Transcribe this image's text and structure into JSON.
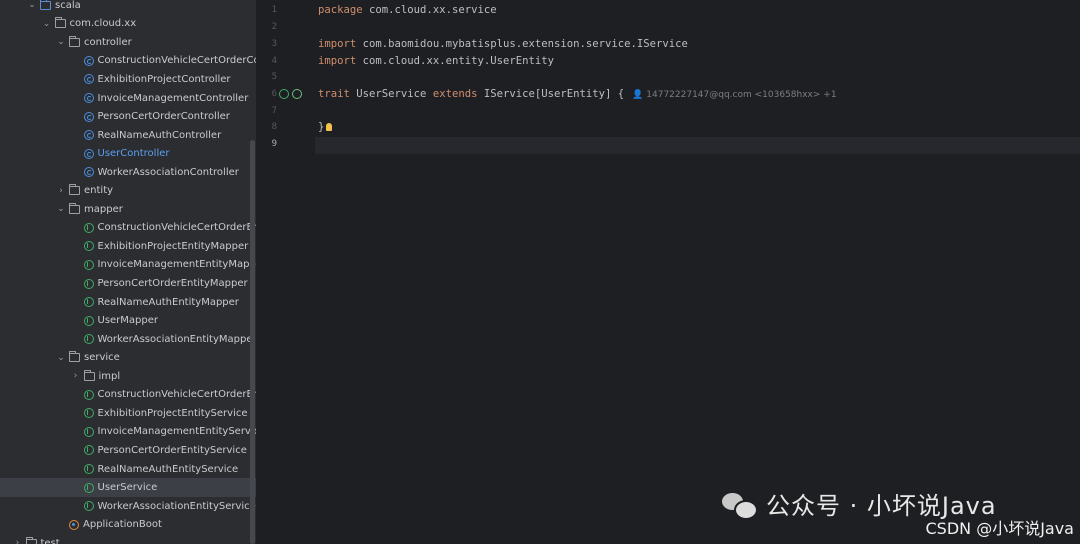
{
  "project_tree": {
    "items": [
      {
        "label": "scala",
        "indent": 2,
        "icon": "folder-icon",
        "expanded": true
      },
      {
        "label": "com.cloud.xx",
        "indent": 3,
        "icon": "folder-icon",
        "expanded": true
      },
      {
        "label": "controller",
        "indent": 4,
        "icon": "folder-icon",
        "expanded": true
      },
      {
        "label": "ConstructionVehicleCertOrderCo",
        "indent": 5,
        "icon": "class-icon"
      },
      {
        "label": "ExhibitionProjectController",
        "indent": 5,
        "icon": "class-icon"
      },
      {
        "label": "InvoiceManagementController",
        "indent": 5,
        "icon": "class-icon"
      },
      {
        "label": "PersonCertOrderController",
        "indent": 5,
        "icon": "class-icon"
      },
      {
        "label": "RealNameAuthController",
        "indent": 5,
        "icon": "class-icon"
      },
      {
        "label": "UserController",
        "indent": 5,
        "icon": "class-icon",
        "link": true
      },
      {
        "label": "WorkerAssociationController",
        "indent": 5,
        "icon": "class-icon"
      },
      {
        "label": "entity",
        "indent": 4,
        "icon": "folder-icon",
        "expanded": false
      },
      {
        "label": "mapper",
        "indent": 4,
        "icon": "folder-icon",
        "expanded": true
      },
      {
        "label": "ConstructionVehicleCertOrderEr",
        "indent": 5,
        "icon": "trait-icon"
      },
      {
        "label": "ExhibitionProjectEntityMapper",
        "indent": 5,
        "icon": "trait-icon"
      },
      {
        "label": "InvoiceManagementEntityMapp",
        "indent": 5,
        "icon": "trait-icon"
      },
      {
        "label": "PersonCertOrderEntityMapper",
        "indent": 5,
        "icon": "trait-icon"
      },
      {
        "label": "RealNameAuthEntityMapper",
        "indent": 5,
        "icon": "trait-icon"
      },
      {
        "label": "UserMapper",
        "indent": 5,
        "icon": "trait-icon"
      },
      {
        "label": "WorkerAssociationEntityMappe",
        "indent": 5,
        "icon": "trait-icon"
      },
      {
        "label": "service",
        "indent": 4,
        "icon": "folder-icon",
        "expanded": true
      },
      {
        "label": "impl",
        "indent": 5,
        "icon": "folder-icon",
        "expanded": false
      },
      {
        "label": "ConstructionVehicleCertOrderEr",
        "indent": 5,
        "icon": "trait-icon"
      },
      {
        "label": "ExhibitionProjectEntityService",
        "indent": 5,
        "icon": "trait-icon"
      },
      {
        "label": "InvoiceManagementEntityServic",
        "indent": 5,
        "icon": "trait-icon"
      },
      {
        "label": "PersonCertOrderEntityService",
        "indent": 5,
        "icon": "trait-icon"
      },
      {
        "label": "RealNameAuthEntityService",
        "indent": 5,
        "icon": "trait-icon"
      },
      {
        "label": "UserService",
        "indent": 5,
        "icon": "trait-icon",
        "selected": true
      },
      {
        "label": "WorkerAssociationEntityService",
        "indent": 5,
        "icon": "trait-icon"
      },
      {
        "label": "ApplicationBoot",
        "indent": 4,
        "icon": "object-icon"
      },
      {
        "label": "test",
        "indent": 1,
        "icon": "folder-icon",
        "expanded": false
      }
    ]
  },
  "editor": {
    "line_numbers": [
      "1",
      "2",
      "3",
      "4",
      "5",
      "6",
      "7",
      "8",
      "9"
    ],
    "current_line": "9",
    "lines": {
      "l1_kw": "package",
      "l1_rest": " com.cloud.xx.service",
      "l3_kw": "import",
      "l3_rest": " com.baomidou.mybatisplus.extension.service.IService",
      "l4_kw": "import",
      "l4_rest": " com.cloud.xx.entity.UserEntity",
      "l6_kw1": "trait",
      "l6_mid": " UserService ",
      "l6_kw2": "extends",
      "l6_rest": " IService[UserEntity] {",
      "l6_hint": "14772227147@qq.com <103658hxx> +1",
      "l8": "}"
    }
  },
  "watermark": {
    "wechat": "公众号 · 小坏说Java",
    "csdn": "CSDN @小坏说Java"
  },
  "colors": {
    "keyword": "#cf8e6d",
    "link": "#5aa0f0",
    "background": "#1e1f22"
  }
}
